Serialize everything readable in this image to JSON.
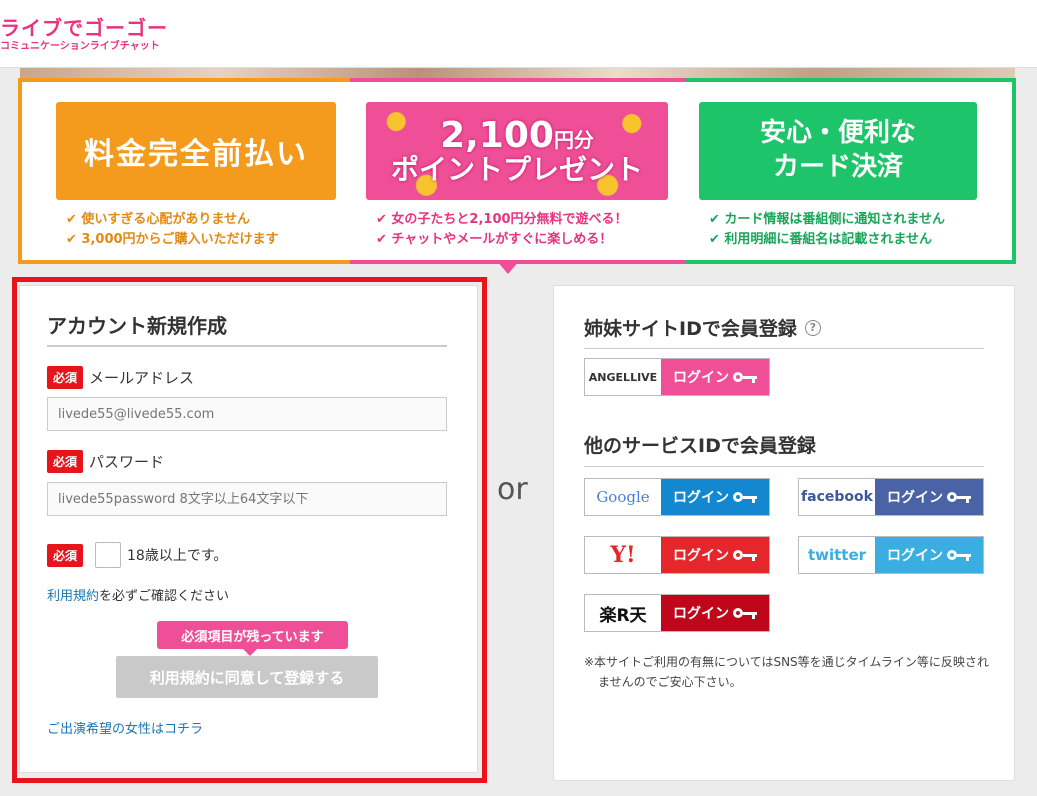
{
  "header": {
    "logo_main": "ライブでゴーゴー",
    "logo_sub": "コミュニケーションライブチャット"
  },
  "banner": {
    "col1": {
      "badge": "料金完全前払い",
      "bullets": [
        "使いすぎる心配がありません",
        "3,000円からご購入いただけます"
      ]
    },
    "col2": {
      "badge_big": "2,100",
      "badge_unit": "円分",
      "badge_mid": "ポイントプレゼント",
      "bullets": [
        "女の子たちと2,100円分無料で遊べる！",
        "チャットやメールがすぐに楽しめる！"
      ]
    },
    "col3": {
      "badge_line1": "安心・便利な",
      "badge_line2": "カード決済",
      "bullets": [
        "カード情報は番組側に通知されません",
        "利用明細に番組名は記載されません"
      ]
    }
  },
  "signup": {
    "title": "アカウント新規作成",
    "required": "必須",
    "email_label": "メールアドレス",
    "email_placeholder": "livede55@livede55.com",
    "password_label": "パスワード",
    "password_placeholder": "livede55password 8文字以上64文字以下",
    "age_label": "18歳以上です。",
    "terms_link": "利用規約",
    "terms_rest": "を必ずご確認ください",
    "tooltip": "必須項目が残っています",
    "submit": "利用規約に同意して登録する",
    "female_link": "ご出演希望の女性はコチラ"
  },
  "or_label": "or",
  "social": {
    "sister_title": "姉妹サイトIDで会員登録",
    "help_icon": "?",
    "other_title": "他のサービスIDで会員登録",
    "login_label": "ログイン",
    "brands": {
      "angel": "ANGELLIVE",
      "google": "Google",
      "facebook": "facebook",
      "yahoo": "Y!",
      "twitter": "twitter",
      "rakuten": "楽R天"
    },
    "note": "※本サイトご利用の有無についてはSNS等を通じタイムライン等に反映されませんのでご安心下さい。"
  },
  "colors": {
    "pink": "#ee4f97",
    "orange": "#f49a1c",
    "green": "#1ec46a",
    "red": "#e8141b",
    "google": "#1388d0",
    "facebook": "#4a63a7",
    "yahoo": "#e5262b",
    "twitter": "#3aaee0",
    "rakuten": "#c0061a"
  }
}
